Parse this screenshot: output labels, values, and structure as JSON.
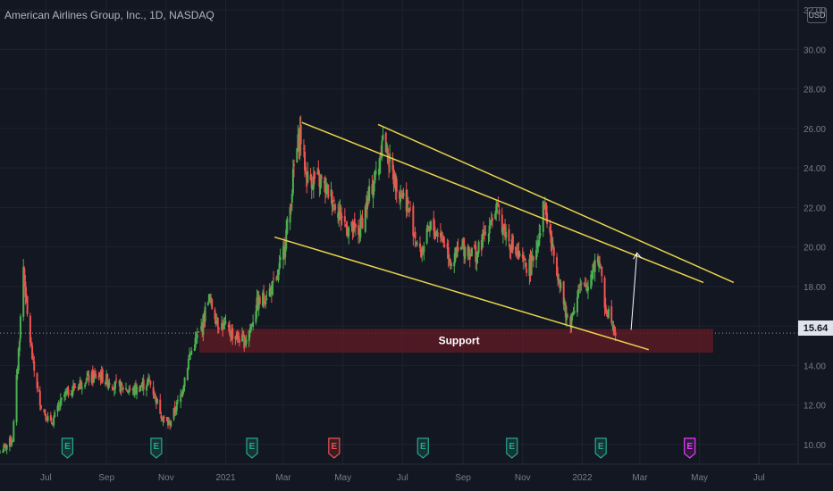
{
  "header": {
    "title": "American Airlines Group, Inc., 1D, NASDAQ",
    "currency": "USD"
  },
  "price_label": "15.64",
  "support_label": "Support",
  "colors": {
    "background": "#131722",
    "up": "#26a69a",
    "up_candle": "#4caf50",
    "down": "#ef5350",
    "trendline": "#e8d44d",
    "support_zone": "#5a1a25",
    "arrow": "#ffffff"
  },
  "events": [
    {
      "date": "2020-07-23",
      "label": "E",
      "type": "earnings",
      "status": "past"
    },
    {
      "date": "2020-10-22",
      "label": "E",
      "type": "earnings",
      "status": "past"
    },
    {
      "date": "2021-01-28",
      "label": "E",
      "type": "earnings",
      "status": "past"
    },
    {
      "date": "2021-04-22",
      "label": "E",
      "type": "earnings",
      "status": "missed"
    },
    {
      "date": "2021-07-22",
      "label": "E",
      "type": "earnings",
      "status": "past"
    },
    {
      "date": "2021-10-21",
      "label": "E",
      "type": "earnings",
      "status": "past"
    },
    {
      "date": "2022-01-20",
      "label": "E",
      "type": "earnings",
      "status": "past"
    },
    {
      "date": "2022-04-21",
      "label": "E",
      "type": "earnings",
      "status": "upcoming"
    }
  ],
  "chart_data": {
    "type": "candlestick",
    "title": "American Airlines Group, Inc., 1D, NASDAQ",
    "y_ticks": [
      10,
      12,
      14,
      16,
      18,
      20,
      22,
      24,
      26,
      28,
      30,
      32
    ],
    "y_tick_labels": [
      "10.00",
      "12.00",
      "14.00",
      "16.00",
      "18.00",
      "20.00",
      "22.00",
      "24.00",
      "26.00",
      "28.00",
      "30.00",
      "32.00"
    ],
    "ylim": [
      9.0,
      32.5
    ],
    "x_range": [
      "2020-05-15",
      "2022-08-10"
    ],
    "x_ticks": [
      {
        "date": "2020-07-01",
        "label": "Jul"
      },
      {
        "date": "2020-09-01",
        "label": "Sep"
      },
      {
        "date": "2020-11-01",
        "label": "Nov"
      },
      {
        "date": "2021-01-01",
        "label": "2021"
      },
      {
        "date": "2021-03-01",
        "label": "Mar"
      },
      {
        "date": "2021-05-01",
        "label": "May"
      },
      {
        "date": "2021-07-01",
        "label": "Jul"
      },
      {
        "date": "2021-09-01",
        "label": "Sep"
      },
      {
        "date": "2021-11-01",
        "label": "Nov"
      },
      {
        "date": "2022-01-01",
        "label": "2022"
      },
      {
        "date": "2022-03-01",
        "label": "Mar"
      },
      {
        "date": "2022-05-01",
        "label": "May"
      },
      {
        "date": "2022-07-01",
        "label": "Jul"
      }
    ],
    "current_price": 15.64,
    "price_path": [
      [
        "2020-05-15",
        9.6
      ],
      [
        "2020-05-28",
        10.3
      ],
      [
        "2020-06-04",
        15.5
      ],
      [
        "2020-06-08",
        19.0
      ],
      [
        "2020-06-12",
        16.5
      ],
      [
        "2020-06-18",
        14.0
      ],
      [
        "2020-06-26",
        12.0
      ],
      [
        "2020-07-06",
        11.0
      ],
      [
        "2020-07-20",
        12.5
      ],
      [
        "2020-08-10",
        13.3
      ],
      [
        "2020-08-25",
        13.5
      ],
      [
        "2020-09-10",
        13.0
      ],
      [
        "2020-09-28",
        12.7
      ],
      [
        "2020-10-15",
        13.2
      ],
      [
        "2020-10-29",
        11.3
      ],
      [
        "2020-11-04",
        11.0
      ],
      [
        "2020-11-16",
        12.5
      ],
      [
        "2020-11-25",
        14.5
      ],
      [
        "2020-12-08",
        16.0
      ],
      [
        "2020-12-14",
        17.5
      ],
      [
        "2020-12-24",
        16.2
      ],
      [
        "2021-01-08",
        15.6
      ],
      [
        "2021-01-20",
        15.2
      ],
      [
        "2021-01-27",
        16.0
      ],
      [
        "2021-02-01",
        17.0
      ],
      [
        "2021-02-10",
        17.5
      ],
      [
        "2021-02-22",
        18.2
      ],
      [
        "2021-03-01",
        19.8
      ],
      [
        "2021-03-08",
        22.0
      ],
      [
        "2021-03-12",
        24.0
      ],
      [
        "2021-03-18",
        25.8
      ],
      [
        "2021-03-25",
        23.5
      ],
      [
        "2021-04-08",
        23.3
      ],
      [
        "2021-04-20",
        22.5
      ],
      [
        "2021-05-05",
        21.0
      ],
      [
        "2021-05-17",
        20.7
      ],
      [
        "2021-05-28",
        22.6
      ],
      [
        "2021-06-07",
        24.2
      ],
      [
        "2021-06-10",
        25.7
      ],
      [
        "2021-06-22",
        23.5
      ],
      [
        "2021-07-06",
        22.2
      ],
      [
        "2021-07-19",
        19.6
      ],
      [
        "2021-07-30",
        21.0
      ],
      [
        "2021-08-10",
        20.6
      ],
      [
        "2021-08-20",
        19.3
      ],
      [
        "2021-09-01",
        20.0
      ],
      [
        "2021-09-15",
        19.6
      ],
      [
        "2021-09-28",
        21.2
      ],
      [
        "2021-10-05",
        21.9
      ],
      [
        "2021-10-18",
        20.3
      ],
      [
        "2021-11-01",
        19.1
      ],
      [
        "2021-11-10",
        19.0
      ],
      [
        "2021-11-18",
        20.8
      ],
      [
        "2021-11-23",
        22.2
      ],
      [
        "2021-12-01",
        20.0
      ],
      [
        "2021-12-10",
        18.1
      ],
      [
        "2021-12-15",
        16.5
      ],
      [
        "2021-12-20",
        16.3
      ],
      [
        "2021-12-28",
        17.8
      ],
      [
        "2022-01-06",
        18.0
      ],
      [
        "2022-01-13",
        19.2
      ],
      [
        "2022-01-18",
        19.4
      ],
      [
        "2022-01-24",
        17.0
      ],
      [
        "2022-01-31",
        16.5
      ],
      [
        "2022-02-04",
        15.64
      ]
    ],
    "annotations": {
      "channel_upper_outer": [
        [
          "2021-03-20",
          26.3
        ],
        [
          "2022-05-05",
          18.2
        ]
      ],
      "channel_upper_inner": [
        [
          "2021-06-06",
          26.2
        ],
        [
          "2022-06-05",
          18.2
        ]
      ],
      "channel_lower": [
        [
          "2021-02-20",
          20.5
        ],
        [
          "2022-03-10",
          14.8
        ]
      ],
      "support_zone": {
        "from": "2020-12-05",
        "to": "2022-05-15",
        "low": 14.65,
        "high": 15.85,
        "label": "Support"
      },
      "projection_arrow": [
        [
          "2022-02-20",
          15.8
        ],
        [
          "2022-02-26",
          19.7
        ]
      ]
    }
  }
}
